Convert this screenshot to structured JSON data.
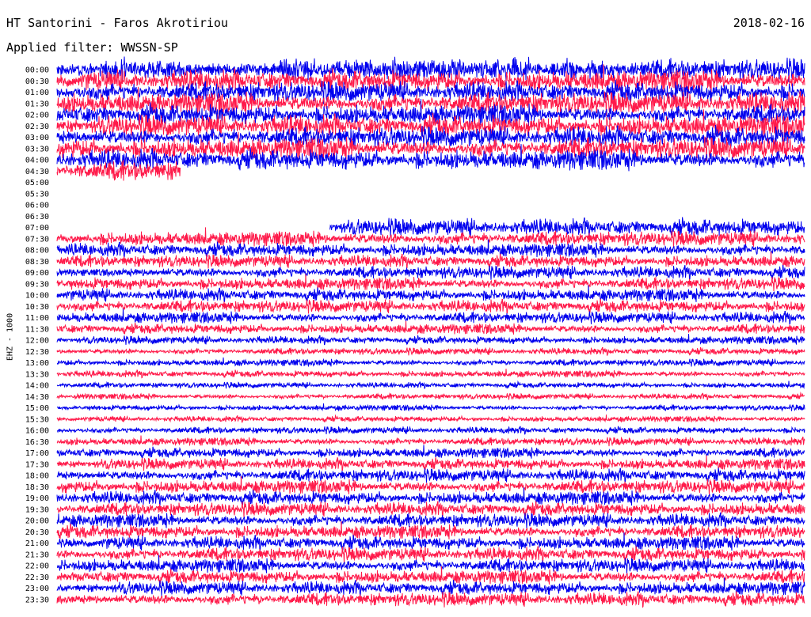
{
  "header": {
    "station": "HT Santorini - Faros Akrotiriou",
    "date": "2018-02-16",
    "filter": "Applied filter: WWSSN-SP",
    "channel": "EHZ - 1000"
  },
  "colors": {
    "even_rows": "#0000ee",
    "odd_rows": "#ff1a4a",
    "background": "#ffffff"
  },
  "chart_data": {
    "type": "line",
    "title": "HT Santorini - Faros Akrotiriou",
    "subtitle": "Applied filter: WWSSN-SP",
    "ylabel": "EHZ - 1000",
    "xlabel": "",
    "grid": false,
    "legend": "none",
    "row_labels": [
      "00:00",
      "00:30",
      "01:00",
      "01:30",
      "02:00",
      "02:30",
      "03:00",
      "03:30",
      "04:00",
      "04:30",
      "05:00",
      "05:30",
      "06:00",
      "06:30",
      "07:00",
      "07:30",
      "08:00",
      "08:30",
      "09:00",
      "09:30",
      "10:00",
      "10:30",
      "11:00",
      "11:30",
      "12:00",
      "12:30",
      "13:00",
      "13:30",
      "14:00",
      "14:30",
      "15:00",
      "15:30",
      "16:00",
      "16:30",
      "17:00",
      "17:30",
      "18:00",
      "18:30",
      "19:00",
      "19:30",
      "20:00",
      "20:30",
      "21:00",
      "21:30",
      "22:00",
      "22:30",
      "23:00",
      "23:30"
    ],
    "x_range_minutes": [
      0,
      30
    ],
    "series": [
      {
        "row": "00:00",
        "start": 0,
        "end": 1,
        "amplitude": 0.95
      },
      {
        "row": "00:30",
        "start": 0,
        "end": 1,
        "amplitude": 0.95
      },
      {
        "row": "01:00",
        "start": 0,
        "end": 1,
        "amplitude": 0.9
      },
      {
        "row": "01:30",
        "start": 0,
        "end": 1,
        "amplitude": 0.95
      },
      {
        "row": "02:00",
        "start": 0,
        "end": 1,
        "amplitude": 0.9
      },
      {
        "row": "02:30",
        "start": 0,
        "end": 1,
        "amplitude": 0.95
      },
      {
        "row": "03:00",
        "start": 0,
        "end": 1,
        "amplitude": 0.9
      },
      {
        "row": "03:30",
        "start": 0,
        "end": 1,
        "amplitude": 0.95
      },
      {
        "row": "04:00",
        "start": 0,
        "end": 1,
        "amplitude": 0.9
      },
      {
        "row": "04:30",
        "start": 0,
        "end": 0.165,
        "amplitude": 0.9
      },
      {
        "row": "05:00",
        "start": 0,
        "end": 0,
        "amplitude": 0
      },
      {
        "row": "05:30",
        "start": 0,
        "end": 0,
        "amplitude": 0
      },
      {
        "row": "06:00",
        "start": 0,
        "end": 0,
        "amplitude": 0
      },
      {
        "row": "06:30",
        "start": 0,
        "end": 0,
        "amplitude": 0
      },
      {
        "row": "07:00",
        "start": 0.365,
        "end": 1,
        "amplitude": 0.75
      },
      {
        "row": "07:30",
        "start": 0,
        "end": 1,
        "amplitude": 0.65
      },
      {
        "row": "08:00",
        "start": 0,
        "end": 1,
        "amplitude": 0.6
      },
      {
        "row": "08:30",
        "start": 0,
        "end": 1,
        "amplitude": 0.55
      },
      {
        "row": "09:00",
        "start": 0,
        "end": 1,
        "amplitude": 0.55
      },
      {
        "row": "09:30",
        "start": 0,
        "end": 1,
        "amplitude": 0.55
      },
      {
        "row": "10:00",
        "start": 0,
        "end": 1,
        "amplitude": 0.55
      },
      {
        "row": "10:30",
        "start": 0,
        "end": 1,
        "amplitude": 0.55
      },
      {
        "row": "11:00",
        "start": 0,
        "end": 1,
        "amplitude": 0.5
      },
      {
        "row": "11:30",
        "start": 0,
        "end": 1,
        "amplitude": 0.45
      },
      {
        "row": "12:00",
        "start": 0,
        "end": 1,
        "amplitude": 0.35
      },
      {
        "row": "12:30",
        "start": 0,
        "end": 1,
        "amplitude": 0.3
      },
      {
        "row": "13:00",
        "start": 0,
        "end": 1,
        "amplitude": 0.3
      },
      {
        "row": "13:30",
        "start": 0,
        "end": 1,
        "amplitude": 0.3
      },
      {
        "row": "14:00",
        "start": 0,
        "end": 1,
        "amplitude": 0.25
      },
      {
        "row": "14:30",
        "start": 0,
        "end": 1,
        "amplitude": 0.25
      },
      {
        "row": "15:00",
        "start": 0,
        "end": 1,
        "amplitude": 0.25
      },
      {
        "row": "15:30",
        "start": 0,
        "end": 1,
        "amplitude": 0.25
      },
      {
        "row": "16:00",
        "start": 0,
        "end": 1,
        "amplitude": 0.3
      },
      {
        "row": "16:30",
        "start": 0,
        "end": 1,
        "amplitude": 0.35
      },
      {
        "row": "17:00",
        "start": 0,
        "end": 1,
        "amplitude": 0.45
      },
      {
        "row": "17:30",
        "start": 0,
        "end": 1,
        "amplitude": 0.5
      },
      {
        "row": "18:00",
        "start": 0,
        "end": 1,
        "amplitude": 0.55
      },
      {
        "row": "18:30",
        "start": 0,
        "end": 1,
        "amplitude": 0.6
      },
      {
        "row": "19:00",
        "start": 0,
        "end": 1,
        "amplitude": 0.6
      },
      {
        "row": "19:30",
        "start": 0,
        "end": 1,
        "amplitude": 0.6
      },
      {
        "row": "20:00",
        "start": 0,
        "end": 1,
        "amplitude": 0.6
      },
      {
        "row": "20:30",
        "start": 0,
        "end": 1,
        "amplitude": 0.6
      },
      {
        "row": "21:00",
        "start": 0,
        "end": 1,
        "amplitude": 0.6
      },
      {
        "row": "21:30",
        "start": 0,
        "end": 1,
        "amplitude": 0.6
      },
      {
        "row": "22:00",
        "start": 0,
        "end": 1,
        "amplitude": 0.6
      },
      {
        "row": "22:30",
        "start": 0,
        "end": 1,
        "amplitude": 0.6
      },
      {
        "row": "23:00",
        "start": 0,
        "end": 1,
        "amplitude": 0.6
      },
      {
        "row": "23:30",
        "start": 0,
        "end": 1,
        "amplitude": 0.6
      }
    ]
  }
}
